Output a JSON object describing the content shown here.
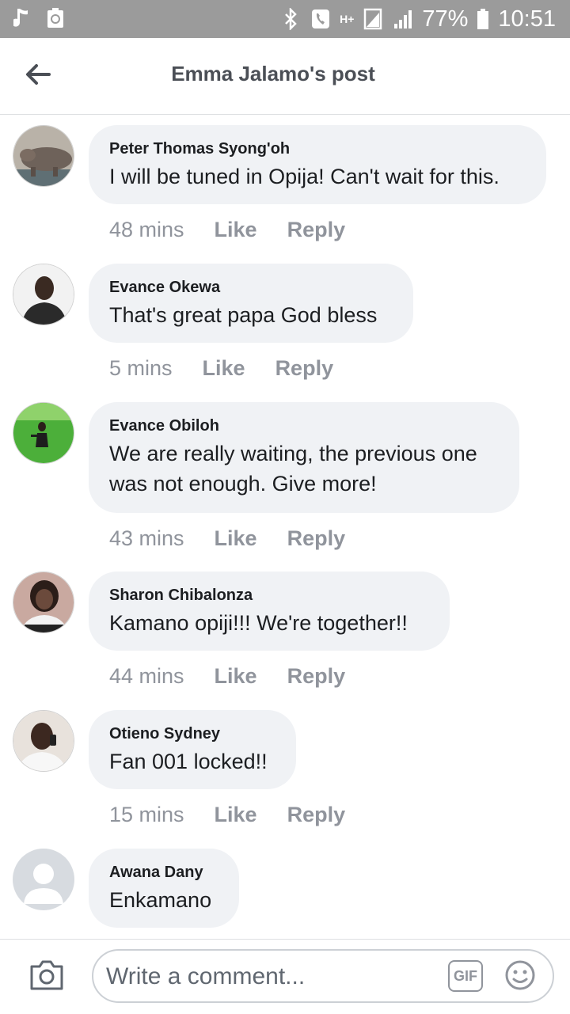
{
  "status_bar": {
    "battery": "77%",
    "time": "10:51",
    "network": "H+",
    "icons": [
      "music-note-icon",
      "recycle-icon",
      "bluetooth-icon",
      "phone-icon",
      "network-icon",
      "sim-icon",
      "signal-icon",
      "battery-icon"
    ]
  },
  "header": {
    "title": "Emma Jalamo's post",
    "back_icon": "back-arrow-icon"
  },
  "comments": [
    {
      "author": "Peter Thomas Syong'oh",
      "text": "I will be tuned in Opija! Can't wait for this.",
      "time": "48 mins",
      "like": "Like",
      "reply": "Reply",
      "avatar": "hippo-photo"
    },
    {
      "author": "Evance Okewa",
      "text": "That's great papa God bless",
      "time": "5 mins",
      "like": "Like",
      "reply": "Reply",
      "avatar": "man-photo"
    },
    {
      "author": "Evance Obiloh",
      "text": "We are really waiting, the previous one was not enough. Give more!",
      "time": "43 mins",
      "like": "Like",
      "reply": "Reply",
      "avatar": "grass-photo"
    },
    {
      "author": "Sharon Chibalonza",
      "text": "Kamano opiji!!! We're together!!",
      "time": "44 mins",
      "like": "Like",
      "reply": "Reply",
      "avatar": "woman-photo"
    },
    {
      "author": "Otieno Sydney",
      "text": "Fan 001 locked!!",
      "time": "15 mins",
      "like": "Like",
      "reply": "Reply",
      "avatar": "man-phone-photo"
    },
    {
      "author": "Awana Dany",
      "text": "Enkamano",
      "avatar": "default-avatar"
    }
  ],
  "composer": {
    "placeholder": "Write a comment...",
    "gif_label": "GIF",
    "icons": [
      "camera-icon",
      "gif-icon",
      "emoji-icon"
    ]
  }
}
